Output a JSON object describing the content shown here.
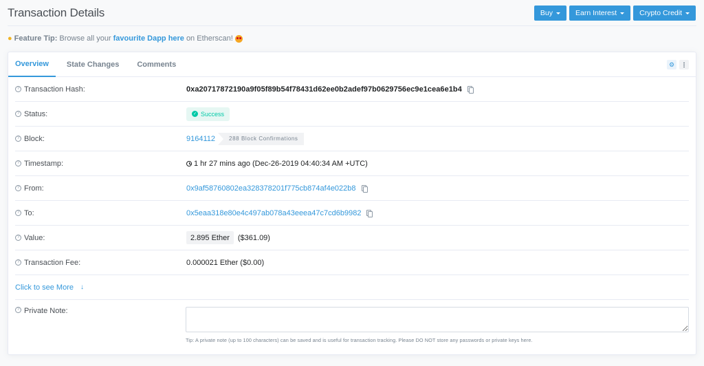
{
  "header": {
    "title": "Transaction Details",
    "buttons": [
      {
        "label": "Buy"
      },
      {
        "label": "Earn Interest"
      },
      {
        "label": "Crypto Credit"
      }
    ]
  },
  "feature_tip": {
    "label": "Feature Tip:",
    "text_before": "Browse all your",
    "link": "favourite Dapp here",
    "text_after": "on Etherscan!"
  },
  "tabs": [
    {
      "label": "Overview",
      "active": true
    },
    {
      "label": "State Changes",
      "active": false
    },
    {
      "label": "Comments",
      "active": false
    }
  ],
  "help_glyph": "?",
  "rows": {
    "hash": {
      "label": "Transaction Hash:",
      "value": "0xa20717872190a9f05f89b54f78431d62ee0b2adef97b0629756ec9e1cea6e1b4"
    },
    "status": {
      "label": "Status:",
      "value": "Success",
      "color": "#00c9a7"
    },
    "block": {
      "label": "Block:",
      "number": "9164112",
      "confirmations": "288 Block Confirmations"
    },
    "timestamp": {
      "label": "Timestamp:",
      "value": "1 hr 27 mins ago (Dec-26-2019 04:40:34 AM +UTC)"
    },
    "from": {
      "label": "From:",
      "value": "0x9af58760802ea328378201f775cb874af4e022b8"
    },
    "to": {
      "label": "To:",
      "value": "0x5eaa318e80e4c497ab078a43eeea47c7cd6b9982"
    },
    "value": {
      "label": "Value:",
      "ether": "2.895 Ether",
      "usd": "($361.09)"
    },
    "fee": {
      "label": "Transaction Fee:",
      "value": "0.000021 Ether ($0.00)"
    }
  },
  "see_more": {
    "label": "Click to see More",
    "arrow": "↓"
  },
  "private_note": {
    "label": "Private Note:",
    "value": "",
    "tip": "Tip: A private note (up to 100 characters) can be saved and is useful for transaction tracking. Please DO NOT store any passwords or private keys here."
  },
  "colors": {
    "accent": "#3498db",
    "success": "#00c9a7"
  }
}
